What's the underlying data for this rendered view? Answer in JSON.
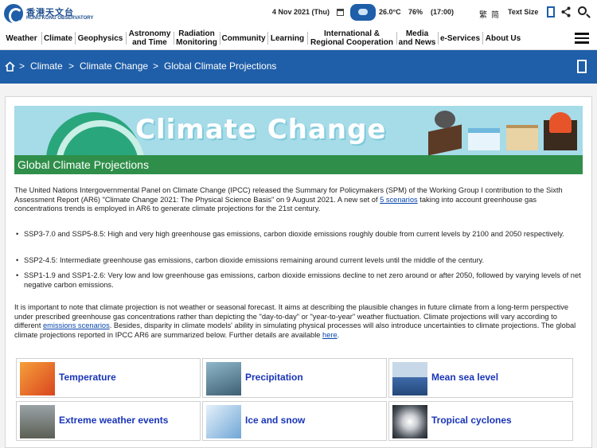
{
  "header": {
    "logo_cn": "香港天文台",
    "logo_en": "HONG KONG OBSERVATORY",
    "date": "4 Nov 2021 (Thu)",
    "temperature": "26.0°C",
    "humidity": "76%",
    "time": "(17:00)",
    "lang_trad": "繁",
    "lang_simp": "简",
    "text_size": "Text Size"
  },
  "nav": {
    "items": [
      {
        "line1": "Weather",
        "line2": ""
      },
      {
        "line1": "Climate",
        "line2": ""
      },
      {
        "line1": "Geophysics",
        "line2": ""
      },
      {
        "line1": "Astronomy",
        "line2": "and Time"
      },
      {
        "line1": "Radiation",
        "line2": "Monitoring"
      },
      {
        "line1": "Community",
        "line2": ""
      },
      {
        "line1": "Learning",
        "line2": ""
      },
      {
        "line1": "International &",
        "line2": "Regional Cooperation"
      },
      {
        "line1": "Media",
        "line2": "and News"
      },
      {
        "line1": "e-Services",
        "line2": ""
      },
      {
        "line1": "About Us",
        "line2": ""
      }
    ]
  },
  "breadcrumb": {
    "sep": ">",
    "items": [
      "Climate",
      "Climate Change",
      "Global Climate Projections"
    ]
  },
  "banner": {
    "title": "Climate Change"
  },
  "section": {
    "title": "Global Climate Projections"
  },
  "intro": {
    "text_before": "The United Nations Intergovernmental Panel on Climate Change (IPCC) released the Summary for Policymakers (SPM) of the Working Group I contribution to the Sixth Assessment Report (AR6) \"Climate Change 2021: The Physical Science Basis\" on 9 August 2021. A new set of ",
    "link": "5 scenarios",
    "text_after": " taking into account greenhouse gas concentrations trends is employed in AR6 to generate climate projections for the 21st century."
  },
  "bullets": [
    "SSP3-7.0 and SSP5-8.5: High and very high greenhouse gas emissions, carbon dioxide emissions roughly double from current levels by 2100 and 2050 respectively.",
    "SSP2-4.5: Intermediate greenhouse gas emissions, carbon dioxide emissions remaining around current levels until the middle of the century.",
    "SSP1-1.9 and SSP1-2.6: Very low and low greenhouse gas emissions, carbon dioxide emissions decline to net zero around or after 2050, followed by varying levels of net negative carbon emissions."
  ],
  "note": {
    "text_1": "It is important to note that climate projection is not weather or seasonal forecast. It aims at describing the plausible changes in future climate from a long-term perspective under prescribed greenhouse gas concentrations rather than depicting the \"day-to-day\" or \"year-to-year\" weather fluctuation. Climate projections will vary according to different ",
    "link_1": "emissions scenarios",
    "text_2": ". Besides, disparity in climate models' ability in simulating physical processes will also introduce uncertainties to climate projections. The global climate projections reported in IPCC AR6 are summarized below. Further details are available ",
    "link_2": "here",
    "text_3": "."
  },
  "tiles": [
    {
      "label": "Temperature"
    },
    {
      "label": "Precipitation"
    },
    {
      "label": "Mean sea level"
    },
    {
      "label": "Extreme weather events"
    },
    {
      "label": "Ice and snow"
    },
    {
      "label": "Tropical cyclones"
    }
  ],
  "colors": {
    "brand_blue": "#1f5ea8",
    "section_green": "#2f8f4a",
    "link_blue": "#1a35b8",
    "banner_sky": "#a6dbe8"
  }
}
